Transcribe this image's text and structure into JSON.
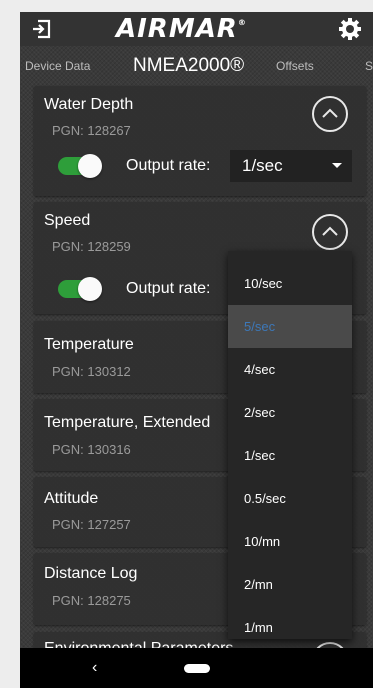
{
  "app": {
    "brand": "AIRMAR",
    "brand_mark": "®"
  },
  "tabs": [
    {
      "label": "Device Data"
    },
    {
      "label": "NMEA2000®"
    },
    {
      "label": "Offsets"
    },
    {
      "label": "S"
    }
  ],
  "cards": [
    {
      "title": "Water Depth",
      "pgn": "PGN: 128267",
      "expanded": true,
      "output_enabled": true,
      "rate_label": "Output rate:",
      "rate_value": "1/sec"
    },
    {
      "title": "Speed",
      "pgn": "PGN: 128259",
      "expanded": true,
      "output_enabled": true,
      "rate_label": "Output rate:"
    },
    {
      "title": "Temperature",
      "pgn": "PGN: 130312"
    },
    {
      "title": "Temperature, Extended",
      "pgn": "PGN: 130316"
    },
    {
      "title": "Attitude",
      "pgn": "PGN: 127257"
    },
    {
      "title": "Distance Log",
      "pgn": "PGN: 128275"
    },
    {
      "title": "Environmental Parameters"
    }
  ],
  "dropdown": {
    "options": [
      "10/sec",
      "5/sec",
      "4/sec",
      "2/sec",
      "1/sec",
      "0.5/sec",
      "10/mn",
      "2/mn",
      "1/mn"
    ],
    "selected": "5/sec"
  },
  "navbar": {
    "back": "‹"
  },
  "colors": {
    "toggle_on": "#2e9e3a",
    "selected_text": "#3d78b8",
    "background": "#3a3a3a"
  },
  "icons": [
    "exit-icon",
    "gear-icon",
    "chevron-up-icon",
    "back-nav-icon",
    "home-nav-icon"
  ]
}
